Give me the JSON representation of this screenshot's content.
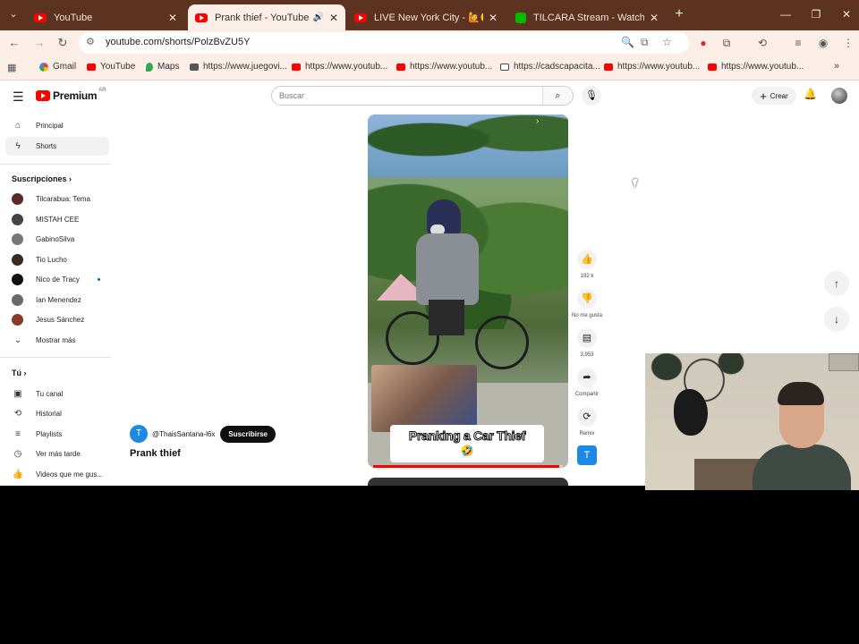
{
  "browser": {
    "tabs": [
      {
        "title": "YouTube",
        "active": false
      },
      {
        "title": "Prank thief - YouTube",
        "active": true
      },
      {
        "title": "LIVE New York City - 🙋🙂 Hot",
        "active": false
      },
      {
        "title": "TILCARA Stream - Watch Live o",
        "active": false
      }
    ],
    "url": "youtube.com/shorts/PolzBvZU5Y",
    "bookmarks": [
      {
        "label": "Gmail",
        "icon": "gmail-icon"
      },
      {
        "label": "YouTube",
        "icon": "youtube-icon"
      },
      {
        "label": "Maps",
        "icon": "maps-icon"
      },
      {
        "label": "https://www.juegovi...",
        "icon": "site-icon"
      },
      {
        "label": "https://www.youtub...",
        "icon": "youtube-icon"
      },
      {
        "label": "https://www.youtub...",
        "icon": "youtube-icon"
      },
      {
        "label": "https://cadscapacita...",
        "icon": "site-icon"
      },
      {
        "label": "https://www.youtub...",
        "icon": "youtube-icon"
      },
      {
        "label": "https://www.youtub...",
        "icon": "youtube-icon"
      }
    ]
  },
  "youtube": {
    "logo_text": "Premium",
    "logo_country": "AR",
    "search_placeholder": "Buscar",
    "create_label": "Crear",
    "sidebar": {
      "main": [
        {
          "label": "Principal",
          "icon": "home-icon",
          "active": false
        },
        {
          "label": "Shorts",
          "icon": "shorts-icon",
          "active": true
        }
      ],
      "subscriptions_header": "Suscripciones",
      "subscriptions": [
        {
          "label": "Tilcarabua: Tema",
          "new": false
        },
        {
          "label": "MISTAH CEE",
          "new": false
        },
        {
          "label": "GabinoSilva",
          "new": false
        },
        {
          "label": "Tio Lucho",
          "new": false
        },
        {
          "label": "Nico de Tracy",
          "new": true
        },
        {
          "label": "Ian Menendez",
          "new": false
        },
        {
          "label": "Jesus Sánchez",
          "new": false
        }
      ],
      "show_more": "Mostrar más",
      "you_header": "Tú",
      "you_items": [
        {
          "label": "Tu canal",
          "icon": "channel-icon"
        },
        {
          "label": "Historial",
          "icon": "history-icon"
        },
        {
          "label": "Playlists",
          "icon": "playlist-icon"
        },
        {
          "label": "Ver más tarde",
          "icon": "clock-icon"
        },
        {
          "label": "Videos que me gus...",
          "icon": "thumbs-up-icon"
        }
      ]
    },
    "short": {
      "caption": "Pranking a Car Thief",
      "caption_emoji": "🤣",
      "channel_initial": "T",
      "channel_name": "@ThaisSantana-l6x",
      "subscribe_label": "Suscribirse",
      "title": "Prank thief",
      "progress": 0.98,
      "actions": {
        "like_count": "192 k",
        "dislike_label": "No me gusta",
        "comment_count": "3,953",
        "share_label": "Compartir",
        "remix_label": "Remix"
      }
    }
  }
}
